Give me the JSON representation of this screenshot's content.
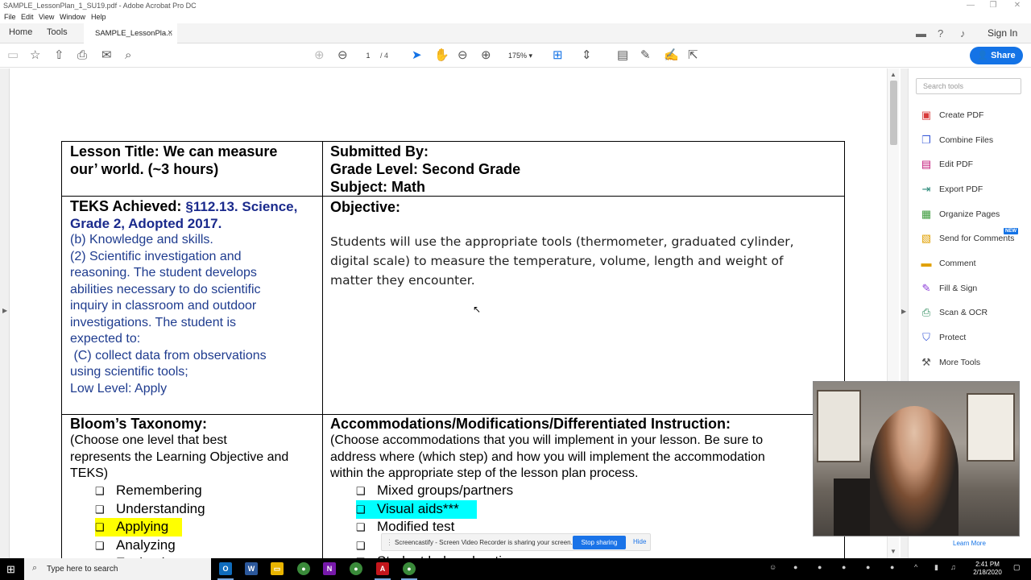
{
  "window": {
    "title": "SAMPLE_LessonPlan_1_SU19.pdf - Adobe Acrobat Pro DC",
    "minimize": "—",
    "restore": "❐",
    "close": "✕"
  },
  "menu": {
    "file": "File",
    "edit": "Edit",
    "view": "View",
    "window": "Window",
    "help": "Help"
  },
  "tabs": {
    "home": "Home",
    "tools": "Tools",
    "document": "SAMPLE_LessonPla...",
    "close": "×"
  },
  "header": {
    "sign_in": "Sign In",
    "share": "Share"
  },
  "toolbar": {
    "page_current": "1",
    "page_total": "/ 4",
    "zoom": "175%"
  },
  "document": {
    "row1": {
      "lesson_title_1": "Lesson Title: We can measure",
      "lesson_title_2": "our’ world. (~3 hours)",
      "submitted_by": "Submitted By:",
      "grade_level": "Grade Level: Second Grade",
      "subject": "Subject: Math"
    },
    "row2": {
      "teks_label": "TEKS Achieved:",
      "teks_ref_1": "§112.13. Science,",
      "teks_ref_2": "Grade 2, Adopted 2017.",
      "teks_lines": [
        "(b) Knowledge and skills.",
        "(2) Scientific investigation and",
        "reasoning. The student develops",
        "abilities necessary to do scientific",
        "inquiry in classroom and outdoor",
        "investigations. The student is",
        "expected to:",
        " (C) collect data from observations",
        "using scientific tools;",
        "Low Level: Apply"
      ],
      "objective_label": "Objective:",
      "objective_lines": [
        "Students will use the appropriate tools (thermometer, graduated cylinder,",
        "digital scale) to measure the temperature, volume, length and weight of",
        "matter they encounter."
      ]
    },
    "row3": {
      "blooms_label": "Bloom’s Taxonomy:",
      "blooms_desc": [
        "(Choose one level that best",
        "represents the Learning Objective and",
        "TEKS)"
      ],
      "blooms_options": [
        "Remembering",
        "Understanding",
        "Applying",
        "Analyzing",
        "Evaluating"
      ],
      "blooms_selected": "Applying",
      "accom_label": "Accommodations/Modifications/Differentiated Instruction:",
      "accom_desc": [
        "(Choose accommodations that you will implement in your lesson. Be sure to",
        "address where (which step) and how you will implement the accommodation",
        "within the appropriate step of the lesson plan process."
      ],
      "accom_options": [
        "Mixed groups/partners",
        "Visual aids***",
        "Modified test",
        "",
        "Student led exploration"
      ],
      "accom_selected": "Visual aids***",
      "checkbox_glyph": "❑"
    }
  },
  "tools_panel": {
    "search_placeholder": "Search tools",
    "items": [
      {
        "label": "Create PDF",
        "color": "#d83b3b"
      },
      {
        "label": "Combine Files",
        "color": "#3b5bd8"
      },
      {
        "label": "Edit PDF",
        "color": "#c2187a"
      },
      {
        "label": "Export PDF",
        "color": "#2a8a7a"
      },
      {
        "label": "Organize Pages",
        "color": "#3a9a3a"
      },
      {
        "label": "Send for Comments",
        "color": "#e0a000"
      },
      {
        "label": "Comment",
        "color": "#e0a000"
      },
      {
        "label": "Fill & Sign",
        "color": "#8a3ad8"
      },
      {
        "label": "Scan & OCR",
        "color": "#2a8a5a"
      },
      {
        "label": "Protect",
        "color": "#3b5bd8"
      },
      {
        "label": "More Tools",
        "color": "#555555"
      }
    ],
    "new_badge": "NEW",
    "learn_more": "Learn More"
  },
  "screencastify": {
    "message": "Screencastify - Screen Video Recorder is sharing your screen.",
    "stop": "Stop sharing",
    "hide": "Hide"
  },
  "taskbar": {
    "search_placeholder": "Type here to search",
    "time": "2:41 PM",
    "date": "2/18/2020"
  }
}
